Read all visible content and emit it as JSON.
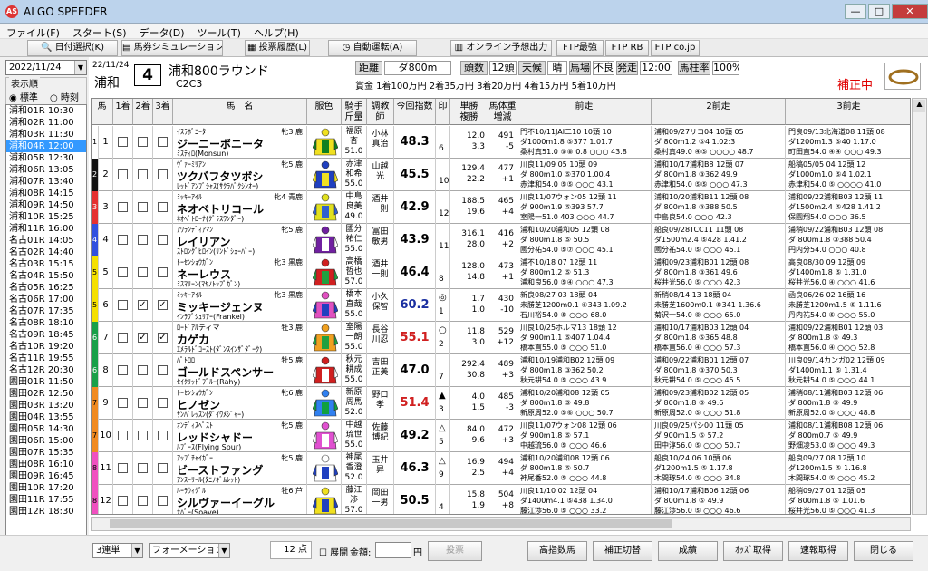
{
  "app": {
    "title": "ALGO SPEEDER",
    "icon": "AS"
  },
  "window_buttons": {
    "minimize": "—",
    "maximize": "□",
    "close": "✕"
  },
  "menu": [
    "ファイル(F)",
    "スタート(S)",
    "データ(D)",
    "ツール(T)",
    "ヘルプ(H)"
  ],
  "toolbar": [
    {
      "label": "日付選択(K)",
      "icon": "search-icon"
    },
    {
      "label": "馬券シミュレーション(B)",
      "icon": "sheet-icon"
    },
    {
      "label": "投票履歴(L)",
      "icon": "list-icon"
    },
    {
      "label": "自動運転(A)",
      "icon": "clock-icon"
    },
    {
      "label": "オンライン予想出力",
      "icon": "document-icon"
    },
    {
      "label": "FTP最強",
      "icon": ""
    },
    {
      "label": "FTP RB",
      "icon": ""
    },
    {
      "label": "FTP co.jp",
      "icon": ""
    }
  ],
  "left": {
    "date": "2022/11/24",
    "order_label": "表示順",
    "order_options": [
      "標準",
      "時刻"
    ],
    "selected_order": "標準",
    "races": [
      "浦和01R 10:30",
      "浦和02R 11:00",
      "浦和03R 11:30",
      "浦和04R 12:00",
      "浦和05R 12:30",
      "浦和06R 13:05",
      "浦和07R 13:40",
      "浦和08R 14:15",
      "浦和09R 14:50",
      "浦和10R 15:25",
      "浦和11R 16:00",
      "名古01R 14:05",
      "名古02R 14:40",
      "名古03R 15:15",
      "名古04R 15:50",
      "名古05R 16:25",
      "名古06R 17:00",
      "名古07R 17:35",
      "名古08R 18:10",
      "名古09R 18:45",
      "名古10R 19:20",
      "名古11R 19:55",
      "名古12R 20:30",
      "園田01R 11:50",
      "園田02R 12:50",
      "園田03R 13:20",
      "園田04R 13:55",
      "園田05R 14:30",
      "園田06R 15:00",
      "園田07R 15:35",
      "園田08R 16:10",
      "園田09R 16:45",
      "園田10R 17:20",
      "園田11R 17:55",
      "園田12R 18:30"
    ],
    "selected_index": 3
  },
  "race": {
    "date": "22/11/24",
    "venue": "浦和",
    "number": "4",
    "name": "浦和800ラウンド",
    "class": "C2C3",
    "distance_label": "距離",
    "distance": "ダ800m",
    "heads_label": "頭数",
    "heads": "12頭",
    "weather_label": "天候",
    "weather": "晴",
    "track_label": "馬場",
    "track": "不良",
    "post_label": "発走",
    "post": "12:00",
    "rate_label": "馬柱率",
    "rate": "100%",
    "prize": "賞金 1着100万円 2着35万円 3着20万円 4着15万円 5着10万円",
    "status": "補正中"
  },
  "columns": [
    "馬",
    "1着",
    "2着",
    "3着",
    "馬　名",
    "服色",
    "騎手\n斤量",
    "調教\n師",
    "今回指数",
    "印",
    "単勝\n複勝",
    "馬体重\n増減",
    "前走",
    "2前走",
    "3前走"
  ],
  "horses": [
    {
      "waku": "1",
      "no": "1",
      "c1": false,
      "c2": false,
      "c3": false,
      "sire": "ｲｽﾗﾎﾞﾆｰﾀ",
      "sex": "牝3 鹿",
      "name": "ジーニーボニータ",
      "dam": "ﾐｽﾃｨﾛ(Monsun)",
      "jockey": "福原\n杏\n51.0",
      "trainer": "小林\n真治",
      "index": "48.3",
      "mark": "",
      "rank": "6",
      "odds": "12.0\n3.3",
      "weight": "491\n-5",
      "p1": "門不10/11JAI二10 10頭 10\nダ1000m1.8 ⑤377 1.01.7\n桑村真51.0 ⑨⑧ 0.8 ○○○ 43.8",
      "p2": "浦和09/27リコ04 10頭 05\nダ 800m1.2 ⑤4 1.02:3\n桑村真49.0 ④⑤ ○○○○ 48.7",
      "p3": "門良09/13北海道08 11頭 08\nダ1200m1.3 ⑤40 1.17.0\n町田直54.0 ④④ ○○○ 49.3"
    },
    {
      "waku": "2",
      "no": "2",
      "c1": false,
      "c2": false,
      "c3": false,
      "sire": "ｳﾞｧｰﾐﾘｱﾝ",
      "sex": "牝5 鹿",
      "name": "ツクバフタツボシ",
      "dam": "ﾚｯﾄﾞｱﾝﾌﾞｼｬｽ(ｻｸﾗﾊﾞｸｼﾝｵｰ)",
      "jockey": "赤津\n和希\n55.0",
      "trainer": "山越\n光",
      "index": "45.5",
      "mark": "",
      "rank": "10",
      "odds": "129.4\n22.2",
      "weight": "477\n+1",
      "p1": "川良11/09 05 10頭 09\nダ 800m1.0 ⑤370 1.00.4\n赤津和54.0 ⑤⑤ ○○○ 43.1",
      "p2": "浦和10/17浦和B8 12頭 07\nダ 800m1.8 ③362 49.9\n赤津和54.0 ⑤⑤ ○○○ 47.3",
      "p3": "船稿05/05 04 12頭 12\nダ1000m1.0 ⑤4 1.02.1\n赤津和54.0 ⑤ ○○○○ 41.0"
    },
    {
      "waku": "3",
      "no": "3",
      "c1": false,
      "c2": false,
      "c3": false,
      "sire": "ﾐｯｷｰｱｲﾙ",
      "sex": "牝4 青鹿",
      "name": "ネオベトリコール",
      "dam": "ﾈｵﾍﾟﾄﾛｰﾅ(ｸﾞﾗｽﾜﾝﾀﾞｰ)",
      "jockey": "中島\n良美\n49.0",
      "trainer": "酒井\n一則",
      "index": "42.9",
      "mark": "",
      "rank": "12",
      "odds": "188.5\n19.6",
      "weight": "465\n+4",
      "p1": "川良11/07ウォン05 12頭 11\nダ 900m1.9 ⑤393 57.7\n室陽一51.0 403 ○○○ 44.7",
      "p2": "浦和10/20浦和B11 12頭 08\nダ 800m1.8 ③388 50.5\n中島良54.0 ○○○ 42.3",
      "p3": "浦和09/22浦和B03 12頭 11\nダ1500m2.4 ⑤428 1.41.2\n保園翔54.0 ○○○ 36.5"
    },
    {
      "waku": "4",
      "no": "4",
      "c1": false,
      "c2": false,
      "c3": false,
      "sire": "ｱﾜﾗﾝﾃﾞｨｱﾏﾝ",
      "sex": "牝5 鹿",
      "name": "レイリアン",
      "dam": "ｽﾄﾛﾝｸﾞﾋﾛｲﾝ(ﾘﾝﾄﾞｼｪｰﾊﾞｰ)",
      "jockey": "國分\n祐仁\n55.0",
      "trainer": "冨田\n敏男",
      "index": "43.9",
      "mark": "",
      "rank": "11",
      "odds": "316.1\n28.0",
      "weight": "416\n+2",
      "p1": "浦和10/20浦和05 12頭 08\nダ 800m1.8 ⑤ 50.5\n國分祐54.0 ⑤⑦ ○○○ 45.1",
      "p2": "船良09/28TCC11 11頭 08\nダ1500m2.4 ⑤428 1.41.2\n國分祐54.0 ⑤ ○○○ 45.1",
      "p3": "浦稍09/22浦和B03 12頭 08\nダ 800m1.8 ③388 50.4\n円内分54.0 ○○○ 40.8"
    },
    {
      "waku": "5",
      "no": "5",
      "c1": false,
      "c2": false,
      "c3": false,
      "sire": "ﾄｰｾﾝｼｮｳｶﾞﾝ",
      "sex": "牝3 黒鹿",
      "name": "ネーレウス",
      "dam": "ﾐｽﾏﾘｰﾝ(ﾏﾔﾉﾄｯﾌﾟｶﾞﾝ)",
      "jockey": "高橋\n哲也\n57.0",
      "trainer": "酒井\n一則",
      "index": "46.4",
      "mark": "",
      "rank": "8",
      "odds": "128.0\n14.8",
      "weight": "473\n+1",
      "p1": "浦不10/18 07 12頭 11\nダ 800m1.2 ⑤ 51.3\n浦和良56.0 ⑤④ ○○○ 47.3",
      "p2": "浦和09/23浦和B01 12頭 08\nダ 800m1.8 ③361 49.6\n桜井光56.0 ⑤ ○○○ 42.3",
      "p3": "高良08/30 09 12頭 09\nダ1400m1.8 ⑤ 1.31.0\n桜井光56.0 ④ ○○○ 41.6"
    },
    {
      "waku": "5",
      "no": "6",
      "c1": false,
      "c2": true,
      "c3": true,
      "sire": "ﾐｯｷｰｱｲﾙ",
      "sex": "牝3 黒鹿",
      "name": "ミッキージェンヌ",
      "dam": "ｲﾝﾗﾌﾞｼｭﾘｱｰ(Frankel)",
      "jockey": "橋本\n直哉\n55.0",
      "trainer": "小久\n保智",
      "index": "60.2",
      "mark": "◎",
      "rank": "1",
      "odds": "1.7\n1.0",
      "weight": "430\n-10",
      "p1": "新良08/27 03 18頭 04\n未勝芝1200m0.1 ⑥343 1.09.2\n石川裕54.0 ⑤ ○○○ 68.0",
      "p2": "新稍08/14 13 18頭 04\n未勝芝1600m0.1 ⑤341 1.36.6\n菊沢一54.0 ⑨ ○○○ 65.0",
      "p3": "函良06/26 02 16頭 16\n未勝芝1200m1.5 ⑤ 1.11.6\n丹内祐54.0 ⑤ ○○○ 55.0"
    },
    {
      "waku": "6",
      "no": "7",
      "c1": false,
      "c2": true,
      "c3": true,
      "sire": "ﾛｰﾄﾞｱﾙティマ",
      "sex": "牡3 鹿",
      "name": "カゲカ",
      "dam": "ｴﾒﾗﾙﾄﾞｺｰｽﾄ(ﾀﾞﾝｽｲﾝｻﾞﾀﾞｰｸ)",
      "jockey": "室陽\n一朗\n55.0",
      "trainer": "長谷\n川忍",
      "index": "55.1",
      "mark": "○",
      "rank": "2",
      "odds": "11.8\n3.0",
      "weight": "529\n+12",
      "p1": "川良10/25ホルマ13 18頭 12\nダ 900m1.1 ⑤407 1.04.4\n橋本直55.0 ⑤ ○○○ 51.0",
      "p2": "浦和10/17浦和B03 12頭 04\nダ 800m1.8 ⑤365 48.8\n橋本直56.0 ④ ○○○ 57.3",
      "p3": "浦和09/22浦和B01 12頭 03\nダ 800m1.8 ⑤ 49.3\n橋本直56.0 ④ ○○○ 52.8"
    },
    {
      "waku": "6",
      "no": "8",
      "c1": false,
      "c2": false,
      "c3": false,
      "sire": "ﾊﾟﾄﾛﾛ",
      "sex": "牡5 鹿",
      "name": "ゴールドスペンサー",
      "dam": "ｾｲｸﾘｯﾄﾞﾌﾞﾙｰ(Rahy)",
      "jockey": "秋元\n耕成\n55.0",
      "trainer": "吉田\n正美",
      "index": "47.0",
      "mark": "",
      "rank": "7",
      "odds": "292.4\n30.8",
      "weight": "489\n+3",
      "p1": "浦和10/19浦和B02 12頭 09\nダ 800m1.8 ③362 50.2\n秋元耕54.0 ⑤ ○○○ 43.9",
      "p2": "浦和09/22浦和B01 12頭 07\nダ 800m1.8 ③370 50.3\n秋元耕54.0 ⑤ ○○○ 45.5",
      "p3": "川良09/14カンガ02 12頭 09\nダ1400m1.1 ⑤ 1.31.4\n秋元耕54.0 ⑤ ○○○ 44.1"
    },
    {
      "waku": "7",
      "no": "9",
      "c1": false,
      "c2": false,
      "c3": false,
      "sire": "ﾄｰｾﾝｼｮｳｶﾞﾝ",
      "sex": "牝6 鹿",
      "name": "ヒノゼン",
      "dam": "ｻﾝﾊﾞﾚｯｽﾝ(ﾀﾞｲﾜﾒｼﾞｬｰ)",
      "jockey": "新原\n周馬\n52.0",
      "trainer": "野口\n孝",
      "index": "51.4",
      "mark": "▲",
      "rank": "3",
      "odds": "4.0\n1.5",
      "weight": "485\n-3",
      "p1": "浦和10/20浦和08 12頭 05\nダ 800m1.8 ⑤ 49.8\n新原周52.0 ⑤⑥ ○○○ 50.7",
      "p2": "浦和09/23浦和B02 12頭 05\nダ 800m1.8 ⑤ 49.6\n新原周52.0 ⑤ ○○○ 51.8",
      "p3": "浦稍08/11浦和B03 12頭 06\nダ 800m1.8 ⑤ 49.9\n新原周52.0 ⑤ ○○○ 48.8"
    },
    {
      "waku": "7",
      "no": "10",
      "c1": false,
      "c2": false,
      "c3": false,
      "sire": "ｵﾝﾃﾞｨｽﾍﾟｽﾄ",
      "sex": "牝5 鹿",
      "name": "レッドシャドー",
      "dam": "ﾙﾌﾞｰｽ(Flying Spur)",
      "jockey": "中越\n琉世\n55.0",
      "trainer": "佐藤\n博紀",
      "index": "49.2",
      "mark": "△",
      "rank": "5",
      "odds": "84.0\n9.6",
      "weight": "472\n+3",
      "p1": "川良11/07ウォン08 12頭 06\nダ 900m1.8 ⑤ 57.1\n中越琉56.0 ⑤ ○○○ 46.6",
      "p2": "川良09/25パシ00 11頭 05\nダ 900m1.5 ⑤ 57.2\n田中淳56.0 ⑤ ○○○ 50.7",
      "p3": "浦和08/11浦和B08 12頭 06\nダ 800m0.7 ⑤ 49.9\n野畑凌53.0 ⑤ ○○○ 49.3"
    },
    {
      "waku": "8",
      "no": "11",
      "c1": false,
      "c2": false,
      "c3": false,
      "sire": "ｱｯﾌﾟﾁｬｲｶﾞｰ",
      "sex": "牝5 鹿",
      "name": "ビーストファング",
      "dam": "ｱﾝｽｰﾘｰﾙ(ﾀﾆﾉｷﾞﾑﾚｯﾄ)",
      "jockey": "神尾\n香澄\n52.0",
      "trainer": "玉井\n昇",
      "index": "46.3",
      "mark": "△",
      "rank": "9",
      "odds": "16.9\n2.5",
      "weight": "494\n+4",
      "p1": "浦和10/20浦和08 12頭 06\nダ 800m1.8 ⑤ 50.7\n神尾香52.0 ⑤ ○○○ 44.8",
      "p2": "船良10/24 06 10頭 06\nダ1200m1.5 ⑤ 1.17.8\n木間琢54.0 ⑤ ○○○ 34.8",
      "p3": "船良09/27 08 12頭 10\nダ1200m1.5 ⑤ 1.16.8\n木間琢54.0 ⑤ ○○○ 45.2"
    },
    {
      "waku": "8",
      "no": "12",
      "c1": false,
      "c2": false,
      "c3": false,
      "sire": "ﾙｰﾗｳｨｸﾞﾙ",
      "sex": "牡6 芦",
      "name": "シルヴァーイーグル",
      "dam": "ﾅﾊﾞｰ(Soave)",
      "jockey": "藤江\n渉\n57.0",
      "trainer": "岡田\n一男",
      "index": "50.5",
      "mark": "",
      "rank": "4",
      "odds": "15.8\n1.9",
      "weight": "504\n+8",
      "p1": "川良11/10 02 12頭 04\nダ1400m4.1 ⑤438 1.34.0\n藤江渉56.0 ⑤ ○○○ 33.2",
      "p2": "浦和10/17浦和B06 12頭 06\nダ 800m1.8 ⑤ 49.9\n藤江渉56.0 ⑤ ○○○ 46.6",
      "p3": "船稍09/27 01 12頭 05\nダ 800m1.8 ⑤ 1.01.6\n桜井光56.0 ⑤ ○○○ 41.3"
    }
  ],
  "bottom": {
    "bet_type": "3連単",
    "bet_method": "フォーメーション",
    "points": "12 点",
    "expand_label": "展開",
    "amount_label": "金額:",
    "amount_unit": "円",
    "vote_label": "投票",
    "buttons": [
      "高指数馬",
      "補正切替",
      "成績",
      "ｵｯｽﾞ取得",
      "速報取得",
      "閉じる"
    ]
  },
  "colors": {
    "waku": [
      "#ffffff",
      "#111111",
      "#e53030",
      "#3050e0",
      "#f5e000",
      "#18a048",
      "#f08a20",
      "#f050c0"
    ],
    "index_high": "#1a2fa0",
    "index_red": "#d02020",
    "status": "#e00000"
  }
}
